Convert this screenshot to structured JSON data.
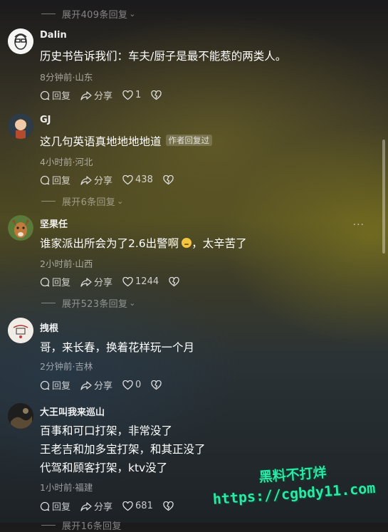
{
  "expand_labels": [
    "展开409条回复",
    "展开6条回复",
    "展开523条回复",
    "展开16条回复"
  ],
  "comments": [
    {
      "user": "Dalin",
      "lines": [
        "历史书告诉我们：车夫/厨子是最不能惹的两类人。"
      ],
      "meta": "8分钟前·山东",
      "reply": "回复",
      "share": "分享",
      "likes": "1"
    },
    {
      "user": "GJ",
      "lines": [
        "这几句英语真地地地地道"
      ],
      "badge": "作者回复过",
      "meta": "4小时前·河北",
      "reply": "回复",
      "share": "分享",
      "likes": "438"
    },
    {
      "user": "坚果任",
      "lines": [
        "谁家派出所会为了2.6出警啊",
        "，太辛苦了"
      ],
      "meta": "2小时前·山西",
      "reply": "回复",
      "share": "分享",
      "likes": "1244"
    },
    {
      "user": "拽根",
      "lines": [
        "哥，来长春，换着花样玩一个月"
      ],
      "meta": "2分钟前·吉林",
      "reply": "回复",
      "share": "分享",
      "likes": "0"
    },
    {
      "user": "大王叫我来巡山",
      "lines": [
        "百事和可口打架，非常没了",
        "王老吉和加多宝打架，和其正没了",
        "代驾和顾客打架，ktv没了"
      ],
      "meta": "1小时前·福建",
      "reply": "回复",
      "share": "分享",
      "likes": "681"
    }
  ],
  "watermark": {
    "line1": "黑料不打烊",
    "line2": "https://cgbdy11.com"
  },
  "more_label": "···",
  "colors": {
    "watermark": "#2ee6a8",
    "badge_bg": "#5a5a52"
  }
}
